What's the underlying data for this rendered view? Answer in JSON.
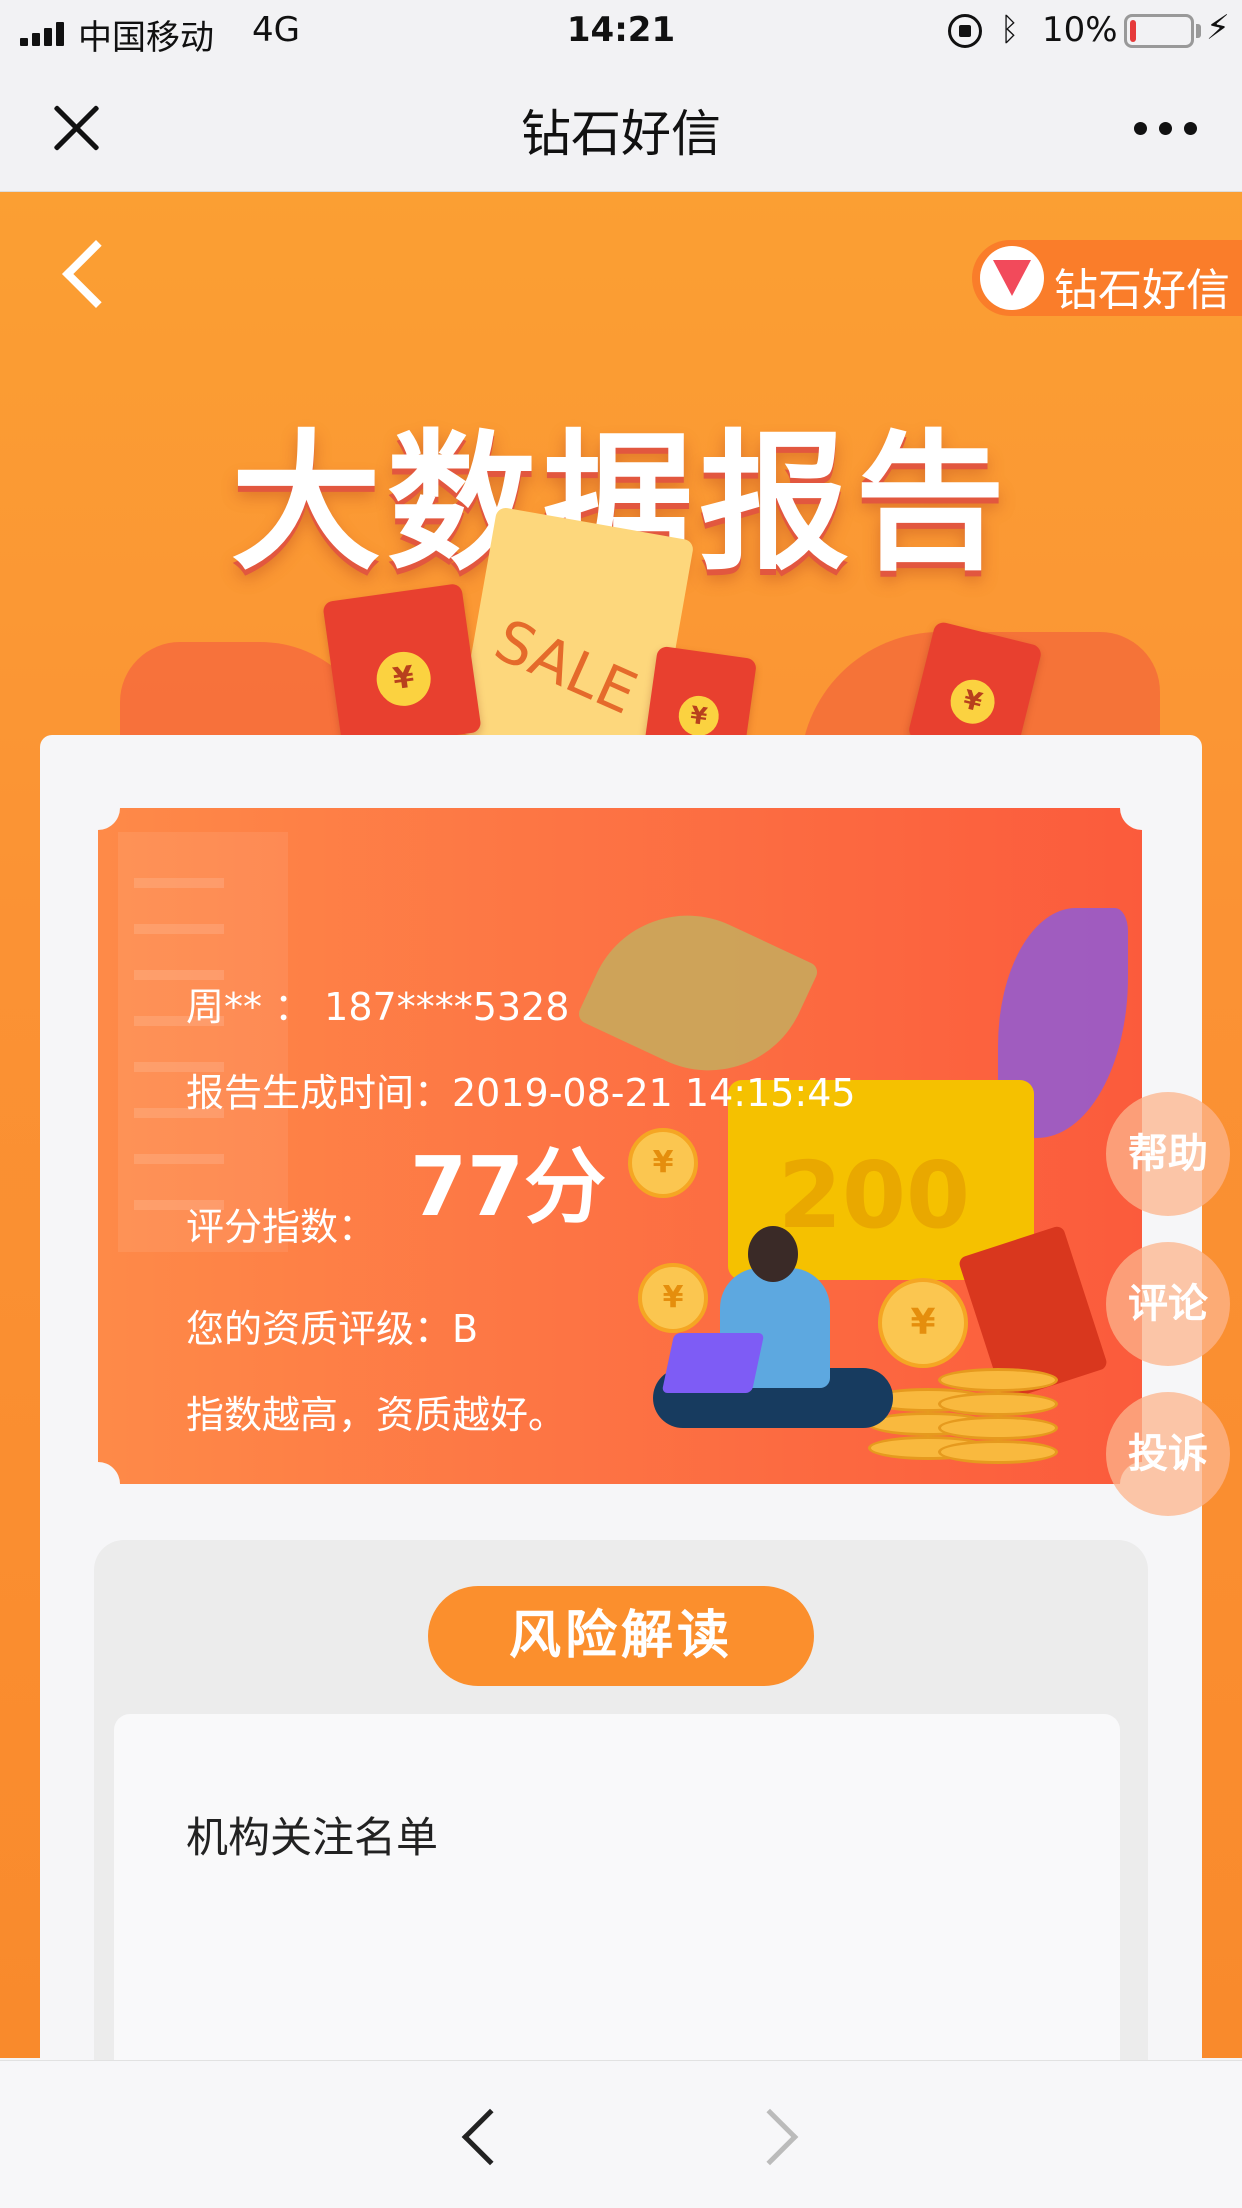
{
  "status_bar": {
    "carrier": "中国移动",
    "network": "4G",
    "time": "14:21",
    "battery_percent": "10%",
    "battery_level": 0.1
  },
  "nav": {
    "title": "钻石好信"
  },
  "brand": {
    "name": "钻石好信"
  },
  "hero": {
    "title": "大数据报告",
    "tag_text": "SALE",
    "envelope_symbol": "¥",
    "card_amount": "200"
  },
  "report": {
    "user_line": "周** ： 187****5328",
    "time_line": "报告生成时间：2019-08-21 14:15:45",
    "score_label": "评分指数：",
    "score_value": "77分",
    "grade_line": "您的资质评级：B",
    "note_line": "指数越高，资质越好。"
  },
  "side_actions": {
    "help": "帮助",
    "comment": "评论",
    "complain": "投诉"
  },
  "risk": {
    "section_label": "风险解读",
    "item_title": "机构关注名单"
  },
  "colors": {
    "hero_orange": "#fb9a32",
    "ticket_orange": "#fd7444",
    "pill_orange": "#fb8f2d",
    "battery_low": "#e63a3a"
  }
}
